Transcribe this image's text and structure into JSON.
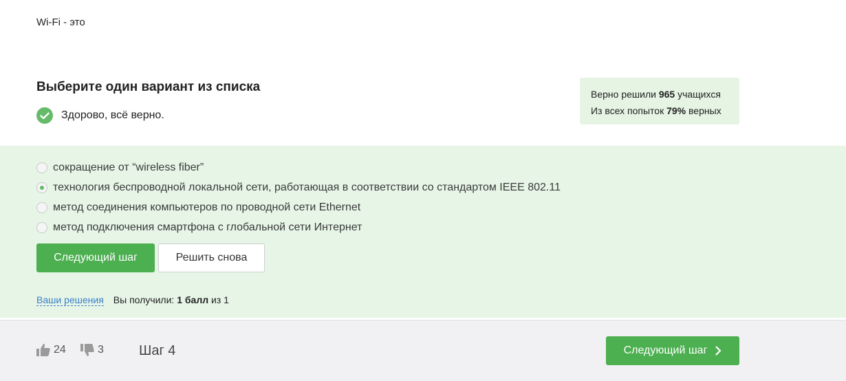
{
  "question": {
    "text": "Wi-Fi - это"
  },
  "quiz": {
    "title": "Выберите один вариант из списка",
    "feedback": "Здорово, всё верно."
  },
  "stats": {
    "line1_prefix": "Верно решили ",
    "solved_count": "965",
    "line1_suffix": " учащихся",
    "line2_prefix": "Из всех попыток ",
    "success_rate": "79%",
    "line2_suffix": " верных"
  },
  "options": [
    {
      "label": "сокращение от “wireless fiber”",
      "selected": false
    },
    {
      "label": "технология беспроводной локальной сети, работающая в соответствии со стандартом IEEE 802.11",
      "selected": true
    },
    {
      "label": "метод соединения компьютеров по проводной сети Ethernet",
      "selected": false
    },
    {
      "label": "метод подключения смартфона с глобальной сети Интернет",
      "selected": false
    }
  ],
  "actions": {
    "next_label": "Следующий шаг",
    "retry_label": "Решить снова"
  },
  "result": {
    "solutions_link": "Ваши решения",
    "score_prefix": "Вы получили: ",
    "score_value": "1 балл",
    "score_suffix": " из 1"
  },
  "footer": {
    "likes": "24",
    "dislikes": "3",
    "step_label": "Шаг 4",
    "next_label": "Следующий шаг"
  },
  "colors": {
    "accent": "#4caf50",
    "answer_bg": "#e6f5e6",
    "link": "#3a7ec8"
  }
}
